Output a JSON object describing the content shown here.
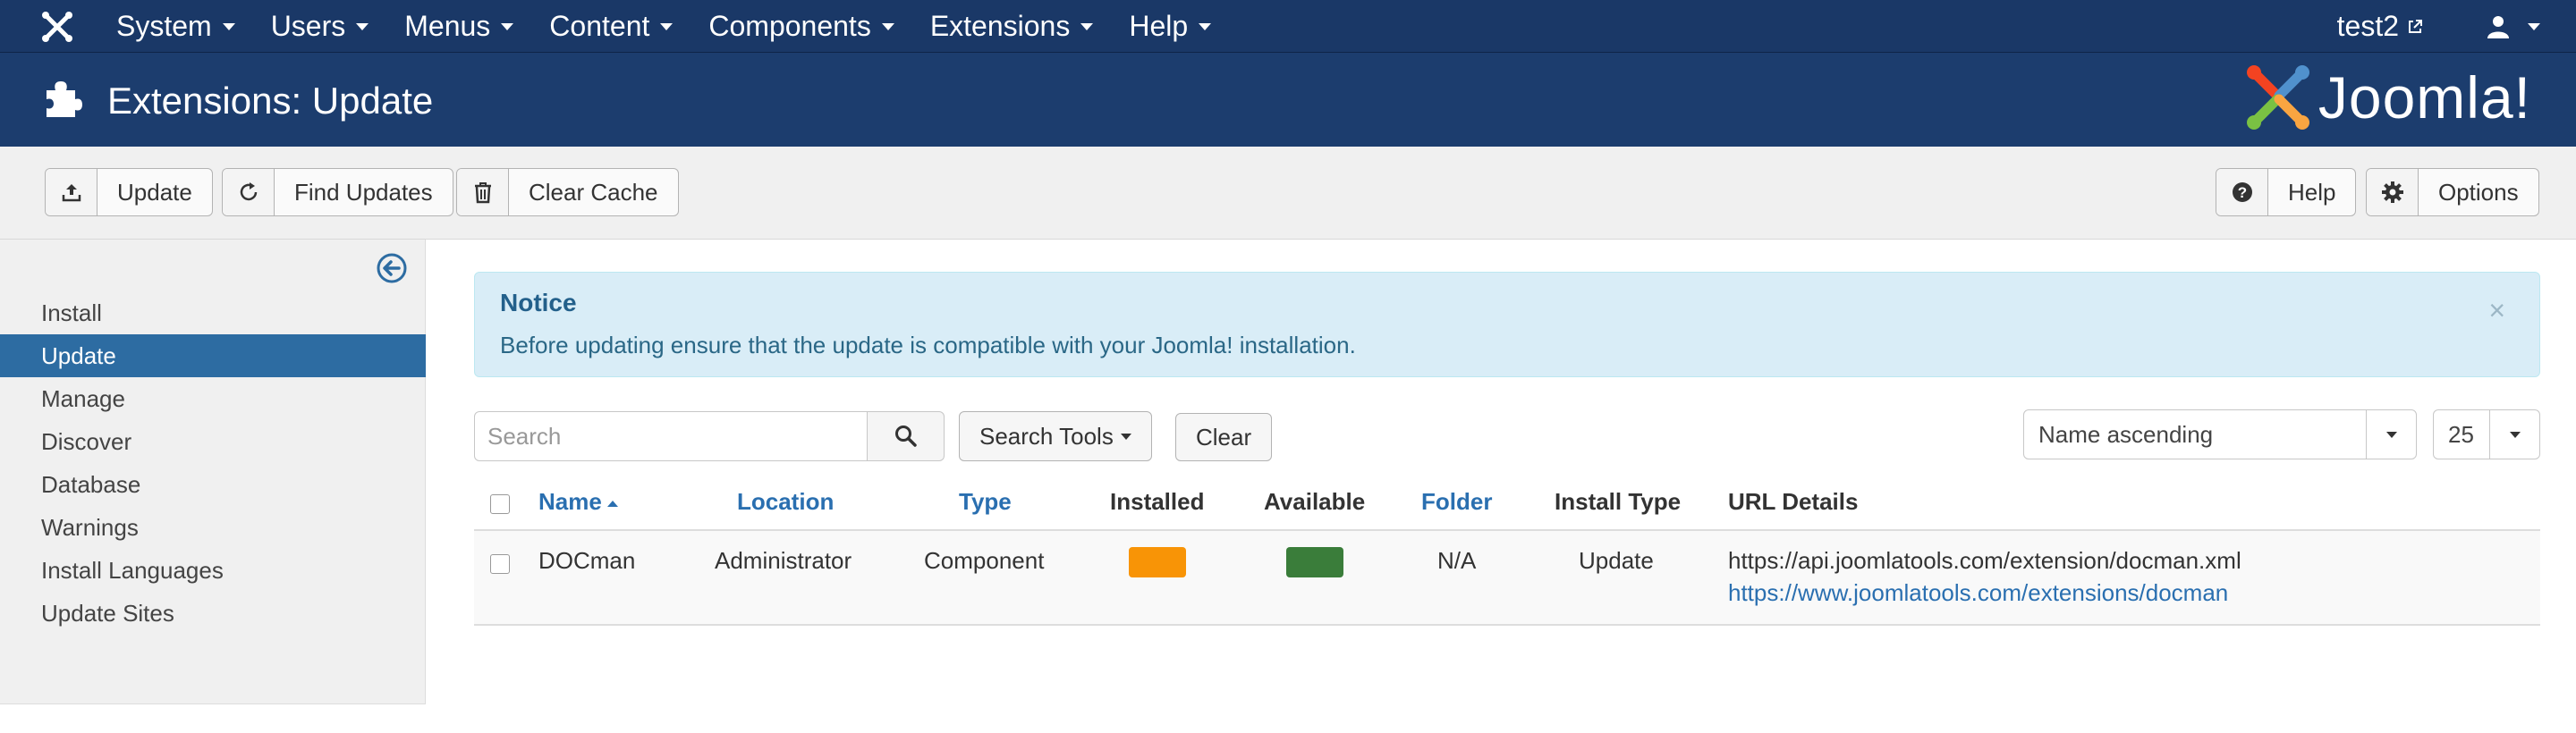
{
  "navbar": {
    "menu": [
      {
        "label": "System"
      },
      {
        "label": "Users"
      },
      {
        "label": "Menus"
      },
      {
        "label": "Content"
      },
      {
        "label": "Components"
      },
      {
        "label": "Extensions"
      },
      {
        "label": "Help"
      }
    ],
    "site_name": "test2"
  },
  "header": {
    "title": "Extensions: Update",
    "brand": "Joomla!"
  },
  "toolbar": {
    "update": "Update",
    "find_updates": "Find Updates",
    "clear_cache": "Clear Cache",
    "help": "Help",
    "options": "Options"
  },
  "sidebar": {
    "items": [
      {
        "label": "Install",
        "active": false
      },
      {
        "label": "Update",
        "active": true
      },
      {
        "label": "Manage",
        "active": false
      },
      {
        "label": "Discover",
        "active": false
      },
      {
        "label": "Database",
        "active": false
      },
      {
        "label": "Warnings",
        "active": false
      },
      {
        "label": "Install Languages",
        "active": false
      },
      {
        "label": "Update Sites",
        "active": false
      }
    ]
  },
  "notice": {
    "title": "Notice",
    "text": "Before updating ensure that the update is compatible with your Joomla! installation.",
    "close": "×"
  },
  "filters": {
    "search_placeholder": "Search",
    "search_tools": "Search Tools",
    "clear": "Clear",
    "ordering": "Name ascending",
    "limit": "25"
  },
  "table": {
    "headers": {
      "name": "Name",
      "location": "Location",
      "type": "Type",
      "installed": "Installed",
      "available": "Available",
      "folder": "Folder",
      "install_type": "Install Type",
      "url_details": "URL Details"
    },
    "rows": [
      {
        "name": "DOCman",
        "location": "Administrator",
        "type": "Component",
        "installed_color": "#f89406",
        "available_color": "#3a7d3a",
        "folder": "N/A",
        "install_type": "Update",
        "url1": "https://api.joomlatools.com/extension/docman.xml",
        "url2": "https://www.joomlatools.com/extensions/docman"
      }
    ]
  },
  "colors": {
    "navbar": "#1a3867",
    "header": "#1c3d6e",
    "active": "#2d6ca2",
    "link": "#2a6fb0"
  }
}
